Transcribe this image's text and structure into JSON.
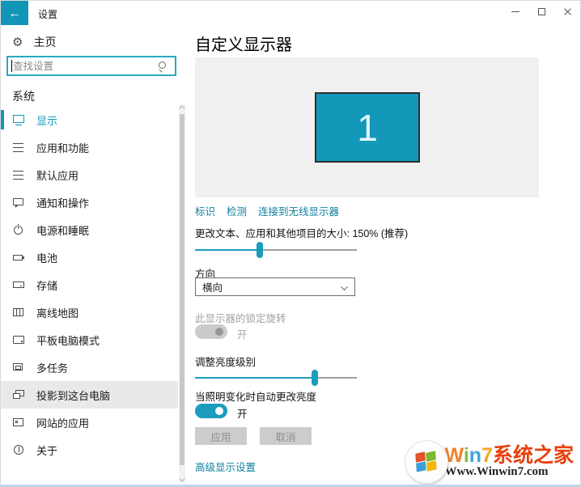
{
  "window": {
    "title": "设置",
    "back_arrow": "←"
  },
  "sidebar": {
    "home_label": "主页",
    "search_placeholder": "查找设置",
    "section_label": "系统",
    "items": [
      {
        "label": "显示",
        "state": "selected"
      },
      {
        "label": "应用和功能",
        "state": "normal"
      },
      {
        "label": "默认应用",
        "state": "normal"
      },
      {
        "label": "通知和操作",
        "state": "normal"
      },
      {
        "label": "电源和睡眠",
        "state": "normal"
      },
      {
        "label": "电池",
        "state": "normal"
      },
      {
        "label": "存储",
        "state": "normal"
      },
      {
        "label": "离线地图",
        "state": "normal"
      },
      {
        "label": "平板电脑模式",
        "state": "normal"
      },
      {
        "label": "多任务",
        "state": "normal"
      },
      {
        "label": "投影到这台电脑",
        "state": "hovered"
      },
      {
        "label": "网站的应用",
        "state": "normal"
      },
      {
        "label": "关于",
        "state": "normal"
      }
    ]
  },
  "main": {
    "title": "自定义显示器",
    "monitor_number": "1",
    "links": {
      "identify": "标识",
      "detect": "检测",
      "wireless": "连接到无线显示器"
    },
    "scaling": {
      "label": "更改文本、应用和其他项目的大小: 150% (推荐)",
      "value_pct": "40%"
    },
    "orientation": {
      "label": "方向",
      "value": "横向"
    },
    "rotation_lock": {
      "label": "此显示器的锁定旋转",
      "state": "开"
    },
    "brightness": {
      "label": "调整亮度级别",
      "value_pct": "74%"
    },
    "auto_brightness": {
      "label": "当照明变化时自动更改亮度",
      "state": "开"
    },
    "buttons": {
      "apply": "应用",
      "cancel": "取消"
    },
    "advanced_link": "高级显示设置"
  },
  "watermark": {
    "w": "W",
    "i": "i",
    "n": "n",
    "seven": "7",
    "site": "系统之家",
    "url": "Www.Winwin7.com"
  },
  "colors": {
    "accent": "#1296b8",
    "link": "#0e7fa0",
    "monitor": "#1398ba"
  }
}
